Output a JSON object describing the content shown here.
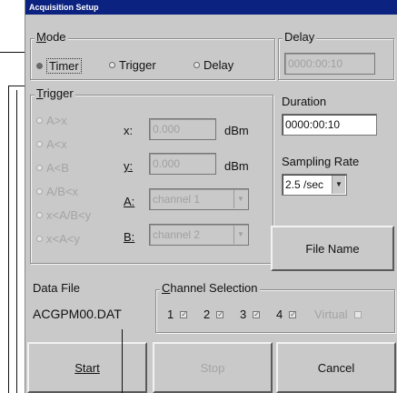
{
  "window": {
    "title": "Acquisition Setup"
  },
  "mode": {
    "legend": "Mode",
    "options": [
      {
        "label": "Timer",
        "selected": true
      },
      {
        "label": "Trigger",
        "selected": false
      },
      {
        "label": "Delay",
        "selected": false
      }
    ]
  },
  "delay": {
    "legend": "Delay",
    "value": "0000:00:10"
  },
  "trigger": {
    "legend": "Trigger",
    "conditions": [
      "A>x",
      "A<x",
      "A<B",
      "A/B<x",
      "x<A/B<y",
      "x<A<y"
    ],
    "x_label": "x:",
    "x_value": "0.000",
    "x_unit": "dBm",
    "y_label": "y:",
    "y_value": "0.000",
    "y_unit": "dBm",
    "a_label": "A:",
    "a_value": "channel 1",
    "b_label": "B:",
    "b_value": "channel 2"
  },
  "duration": {
    "label": "Duration",
    "value": "0000:00:10"
  },
  "sampling": {
    "label": "Sampling Rate",
    "value": "2.5 /sec"
  },
  "buttons": {
    "file_name": "File Name",
    "start": "Start",
    "stop": "Stop",
    "cancel": "Cancel"
  },
  "data_file": {
    "label": "Data File",
    "value": "ACGPM00.DAT"
  },
  "channel_selection": {
    "legend": "Channel Selection",
    "channels": [
      {
        "label": "1",
        "checked": true
      },
      {
        "label": "2",
        "checked": true
      },
      {
        "label": "3",
        "checked": true
      },
      {
        "label": "4",
        "checked": true
      }
    ],
    "virtual_label": "Virtual"
  }
}
